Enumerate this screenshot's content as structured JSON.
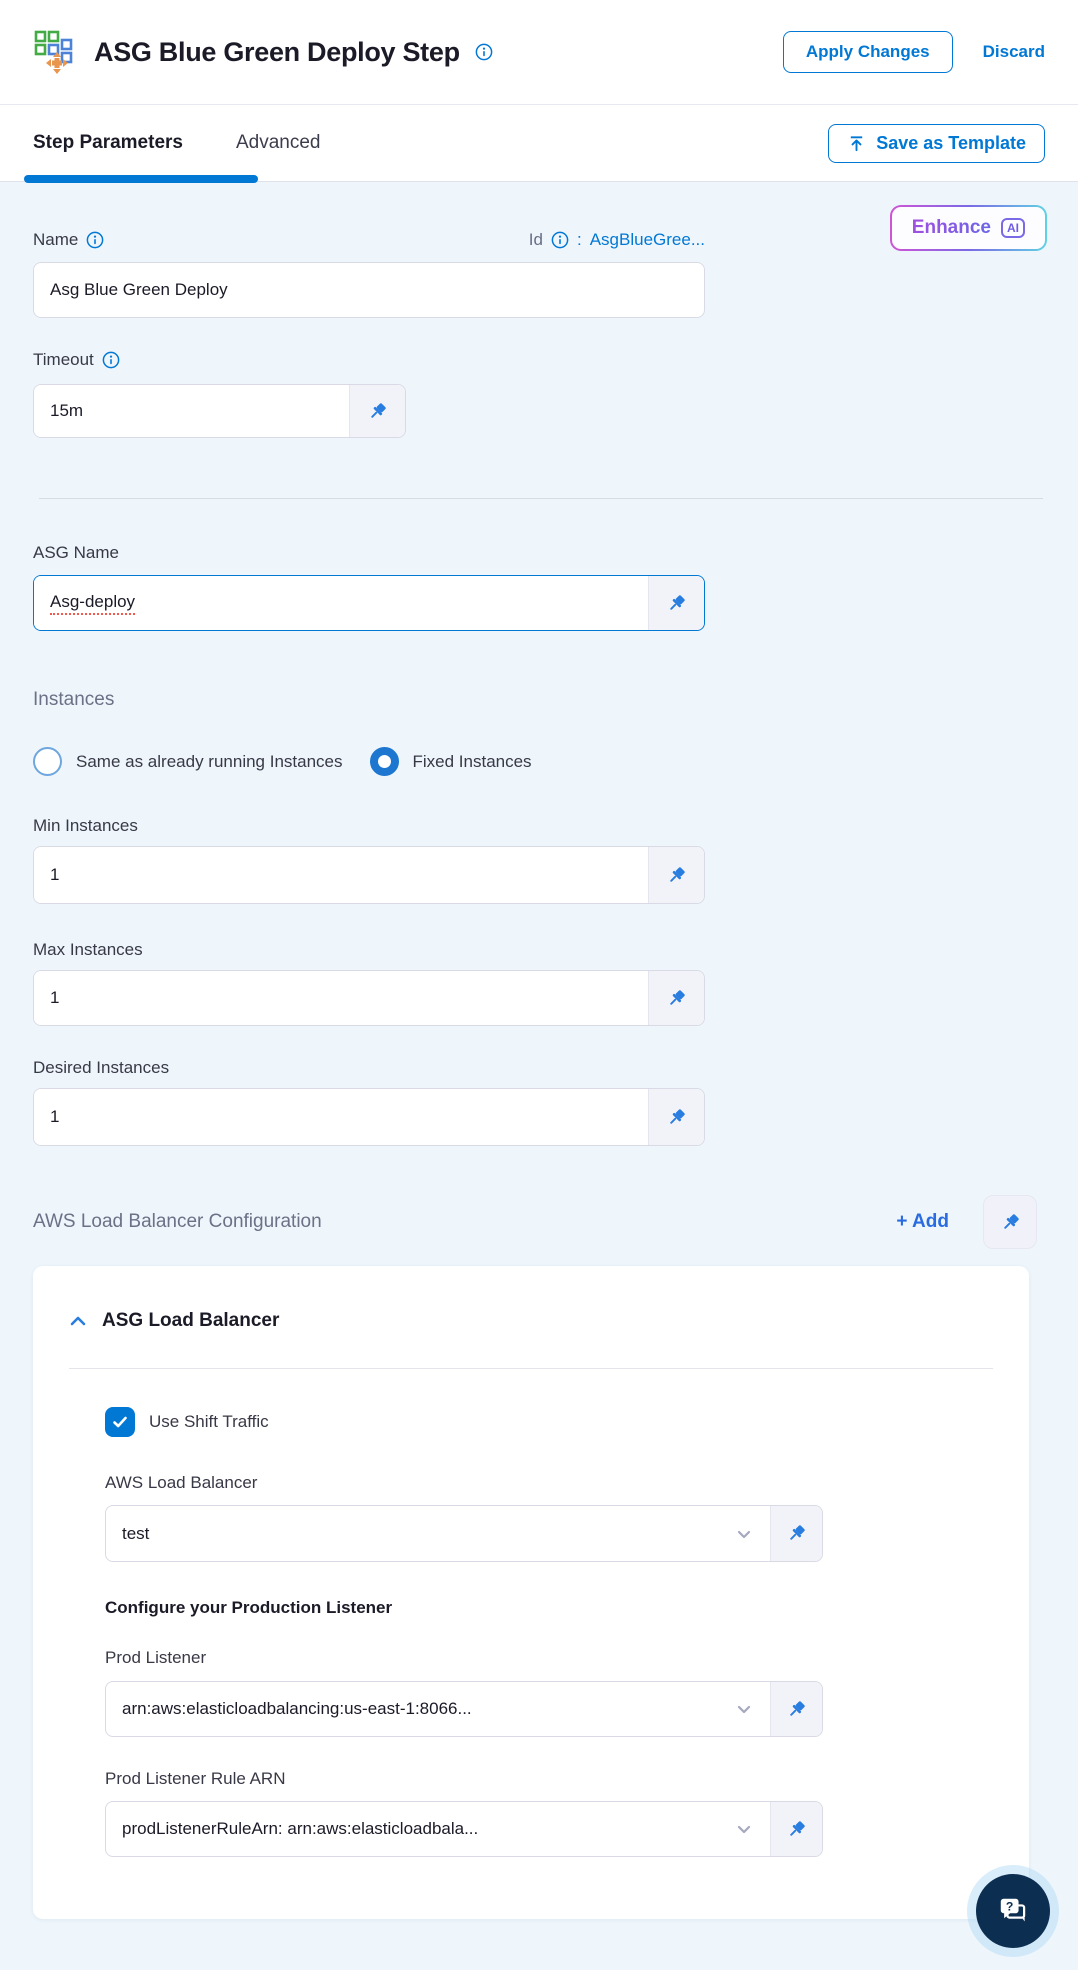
{
  "header": {
    "title": "ASG Blue Green Deploy Step",
    "apply_label": "Apply Changes",
    "discard_label": "Discard"
  },
  "tabs": {
    "step_parameters": "Step Parameters",
    "advanced": "Advanced",
    "save_as_template": "Save as Template"
  },
  "enhance": {
    "label": "Enhance",
    "badge": "AI"
  },
  "form": {
    "name": {
      "label": "Name",
      "value": "Asg Blue Green Deploy"
    },
    "id": {
      "label": "Id",
      "separator": ":",
      "value": "AsgBlueGree..."
    },
    "timeout": {
      "label": "Timeout",
      "value": "15m"
    },
    "asg_name": {
      "label": "ASG Name",
      "value": "Asg-deploy"
    },
    "instances": {
      "heading": "Instances",
      "radio_same_label": "Same as already running Instances",
      "radio_fixed_label": "Fixed Instances",
      "selected": "Fixed Instances"
    },
    "min_instances": {
      "label": "Min Instances",
      "value": "1"
    },
    "max_instances": {
      "label": "Max Instances",
      "value": "1"
    },
    "desired_instances": {
      "label": "Desired Instances",
      "value": "1"
    }
  },
  "lb_section": {
    "heading": "AWS Load Balancer Configuration",
    "add_label": "+ Add",
    "panel_title": "ASG Load Balancer",
    "use_shift_traffic_label": "Use Shift Traffic",
    "use_shift_traffic_checked": true,
    "aws_lb": {
      "label": "AWS Load Balancer",
      "value": "test"
    },
    "prod_heading": "Configure your Production Listener",
    "prod_listener": {
      "label": "Prod Listener",
      "value": "arn:aws:elasticloadbalancing:us-east-1:8066..."
    },
    "prod_listener_rule": {
      "label": "Prod Listener Rule ARN",
      "value": "prodListenerRuleArn: arn:aws:elasticloadbala..."
    }
  },
  "icons": {
    "app_icon": "asg-step (green/blue squares + orange move arrows)",
    "info_icon": "ⓘ",
    "pin_icon": "📌",
    "upload_icon": "↥",
    "chevron_up_icon": "⌃",
    "chevron_down_icon": "⌄",
    "check_icon": "✓",
    "chat_help_icon": "?💬"
  },
  "colors": {
    "primary_blue": "#0278d5",
    "add_link_blue": "#2a6ce0",
    "content_bg": "#eef6fc",
    "fab_navy": "#0c2e50",
    "enhance_gradient": [
      "#cf54d6",
      "#7b68e6",
      "#5fd2e4"
    ],
    "spellcheck_red": "#f0594b"
  }
}
